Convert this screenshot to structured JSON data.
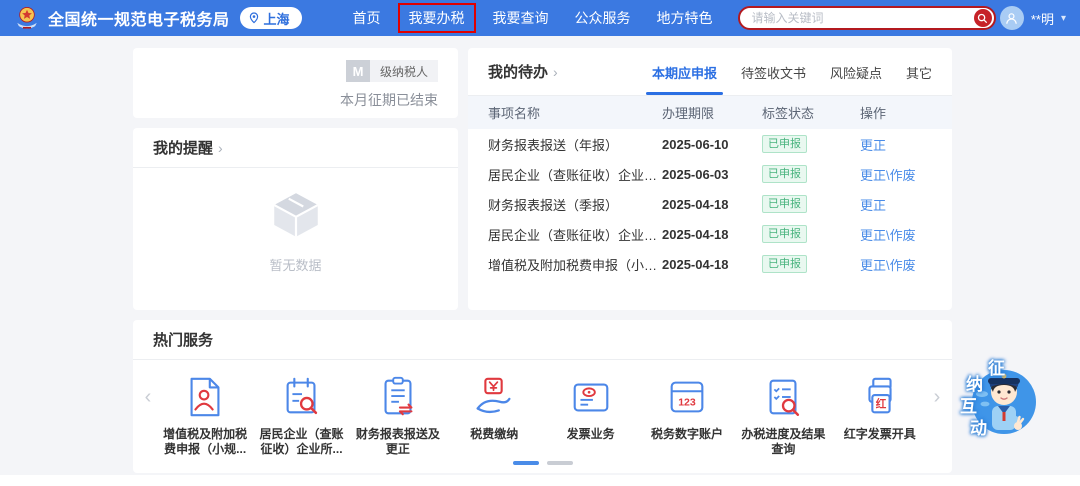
{
  "header": {
    "brand": "全国统一规范电子税务局",
    "location": "上海",
    "nav": [
      {
        "label": "首页",
        "highlighted": false
      },
      {
        "label": "我要办税",
        "highlighted": true
      },
      {
        "label": "我要查询",
        "highlighted": false
      },
      {
        "label": "公众服务",
        "highlighted": false
      },
      {
        "label": "地方特色",
        "highlighted": false
      }
    ],
    "search": {
      "placeholder": "请输入关键词",
      "value": "",
      "icon": "search-icon"
    },
    "user": {
      "name": "**明",
      "avatar_icon": "person-icon",
      "chevron": "˅"
    }
  },
  "taxpayer_card": {
    "level": "M",
    "level_label": "级纳税人",
    "period_status": "本月征期已结束"
  },
  "reminders_card": {
    "title": "我的提醒",
    "arrow": "›",
    "empty_icon": "empty-box-icon",
    "empty_text": "暂无数据"
  },
  "todo_card": {
    "title": "我的待办",
    "arrow": "›",
    "tabs": [
      {
        "label": "本期应申报",
        "active": true
      },
      {
        "label": "待签收文书",
        "active": false
      },
      {
        "label": "风险疑点",
        "active": false
      },
      {
        "label": "其它",
        "active": false
      }
    ],
    "columns": {
      "name": "事项名称",
      "deadline": "办理期限",
      "status": "标签状态",
      "action": "操作"
    },
    "rows": [
      {
        "name": "财务报表报送（年报）",
        "deadline": "2025-06-10",
        "status": "已申报",
        "action": "更正"
      },
      {
        "name": "居民企业（查账征收）企业所得税年度...",
        "deadline": "2025-06-03",
        "status": "已申报",
        "action": "更正\\作废"
      },
      {
        "name": "财务报表报送（季报）",
        "deadline": "2025-04-18",
        "status": "已申报",
        "action": "更正"
      },
      {
        "name": "居民企业（查账征收）企业所得税月（...",
        "deadline": "2025-04-18",
        "status": "已申报",
        "action": "更正\\作废"
      },
      {
        "name": "增值税及附加税费申报（小规模纳税人）",
        "deadline": "2025-04-18",
        "status": "已申报",
        "action": "更正\\作废"
      }
    ],
    "status_color": "#47b37d",
    "link_color": "#4a8ce8"
  },
  "hot_services": {
    "title": "热门服务",
    "prev_arrow": "‹",
    "next_arrow": "›",
    "items": [
      {
        "label": "增值税及附加税费申报（小规...",
        "icon": "vat-declaration-icon"
      },
      {
        "label": "居民企业（查账征收）企业所...",
        "icon": "resident-enterprise-tax-icon"
      },
      {
        "label": "财务报表报送及更正",
        "icon": "financial-report-icon"
      },
      {
        "label": "税费缴纳",
        "icon": "tax-payment-icon"
      },
      {
        "label": "发票业务",
        "icon": "invoice-business-icon"
      },
      {
        "label": "税务数字账户",
        "icon": "digital-account-icon"
      },
      {
        "label": "办税进度及结果查询",
        "icon": "progress-query-icon"
      },
      {
        "label": "红字发票开具",
        "icon": "red-invoice-icon"
      }
    ],
    "pagination": {
      "pages": 2,
      "active_page": 1
    }
  },
  "mascot": {
    "chars": [
      "征",
      "纳",
      "互",
      "动"
    ],
    "name": "征纳互动"
  },
  "colors": {
    "header_blue": "#3b79e1",
    "highlight_red": "#e00000",
    "search_border_red": "#b3191f",
    "active_tab_blue": "#2b6fe3",
    "link_blue": "#4a8ce8",
    "badge_green_text": "#47b37d",
    "badge_green_bg": "#e9f8f0",
    "page_bg": "#f4f5f8",
    "table_head_bg": "#f3f6fb"
  }
}
